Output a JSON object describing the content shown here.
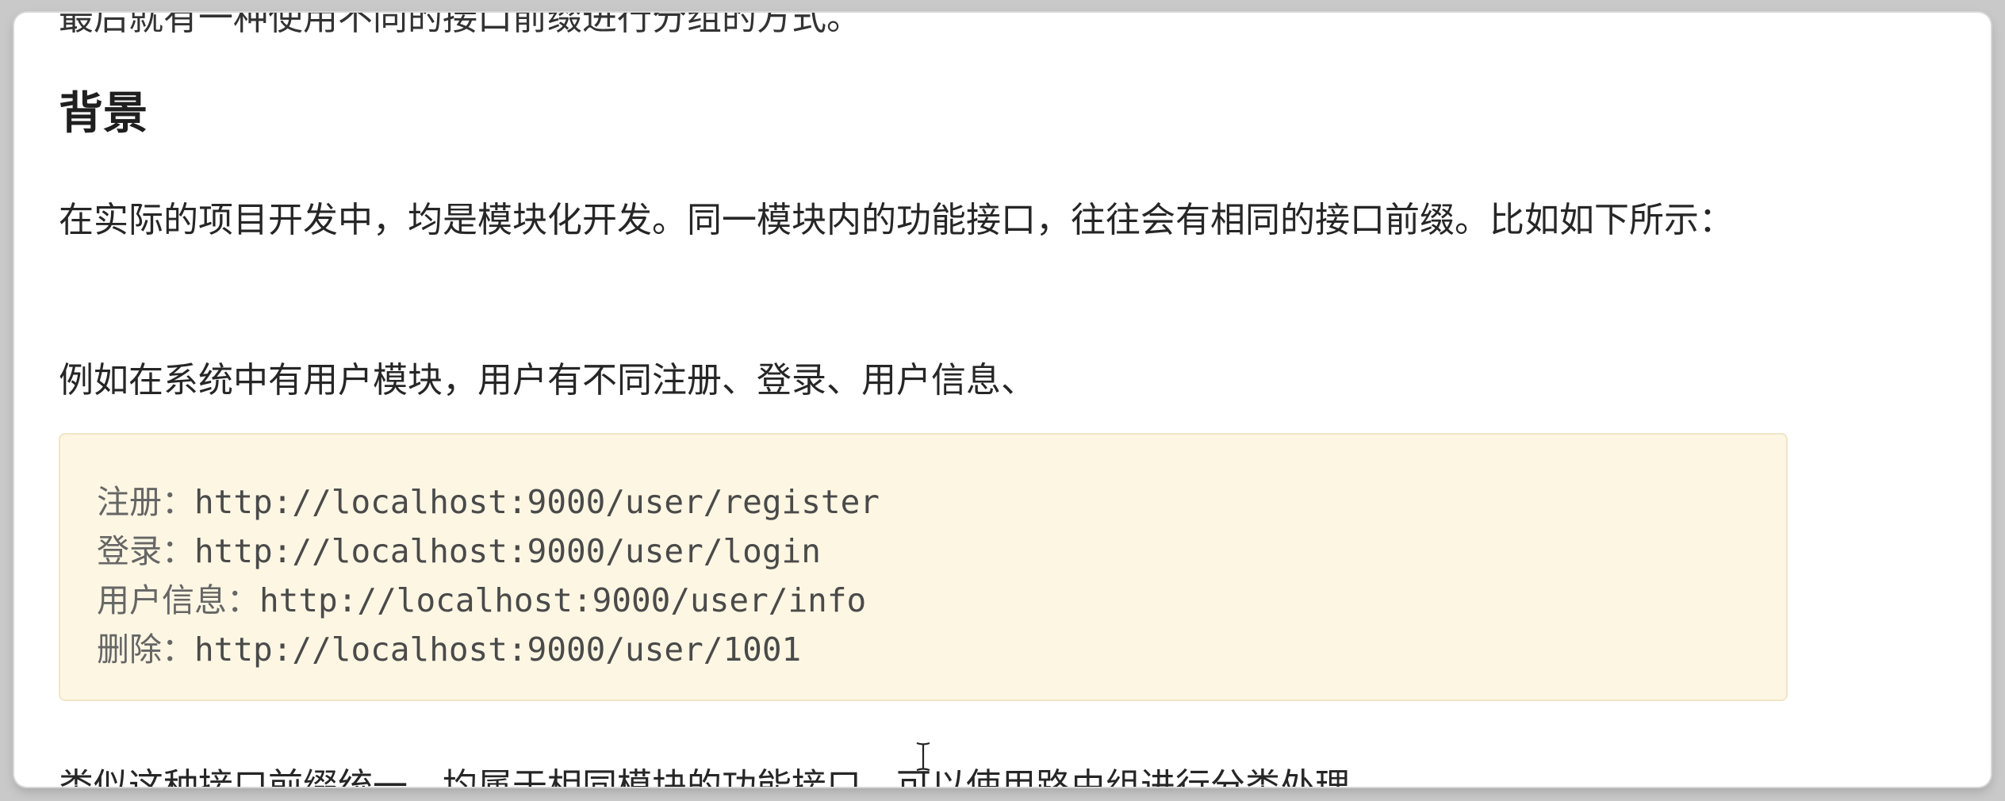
{
  "document": {
    "cutoff_line": "最后就有一种使用不同的接口前缀进行分组的方式。",
    "heading": "背景",
    "paragraph_1": "在实际的项目开发中，均是模块化开发。同一模块内的功能接口，往往会有相同的接口前缀。比如如下所示：",
    "paragraph_2": "例如在系统中有用户模块，用户有不同注册、登录、用户信息、",
    "code_lines": [
      {
        "label": "注册：",
        "url": "http://localhost:9000/user/register"
      },
      {
        "label": "登录：",
        "url": "http://localhost:9000/user/login"
      },
      {
        "label": "用户信息：",
        "url": "http://localhost:9000/user/info"
      },
      {
        "label": "删除：",
        "url": "http://localhost:9000/user/1001"
      }
    ],
    "paragraph_3": "类似这种接口前缀统一，均属于相同模块的功能接口。可以使用路由组进行分类处理。"
  },
  "icons": {
    "cursor": "text-cursor-icon"
  },
  "colors": {
    "code_background": "#fdf6e3",
    "code_border": "#f0e6c8",
    "text": "#262626"
  }
}
